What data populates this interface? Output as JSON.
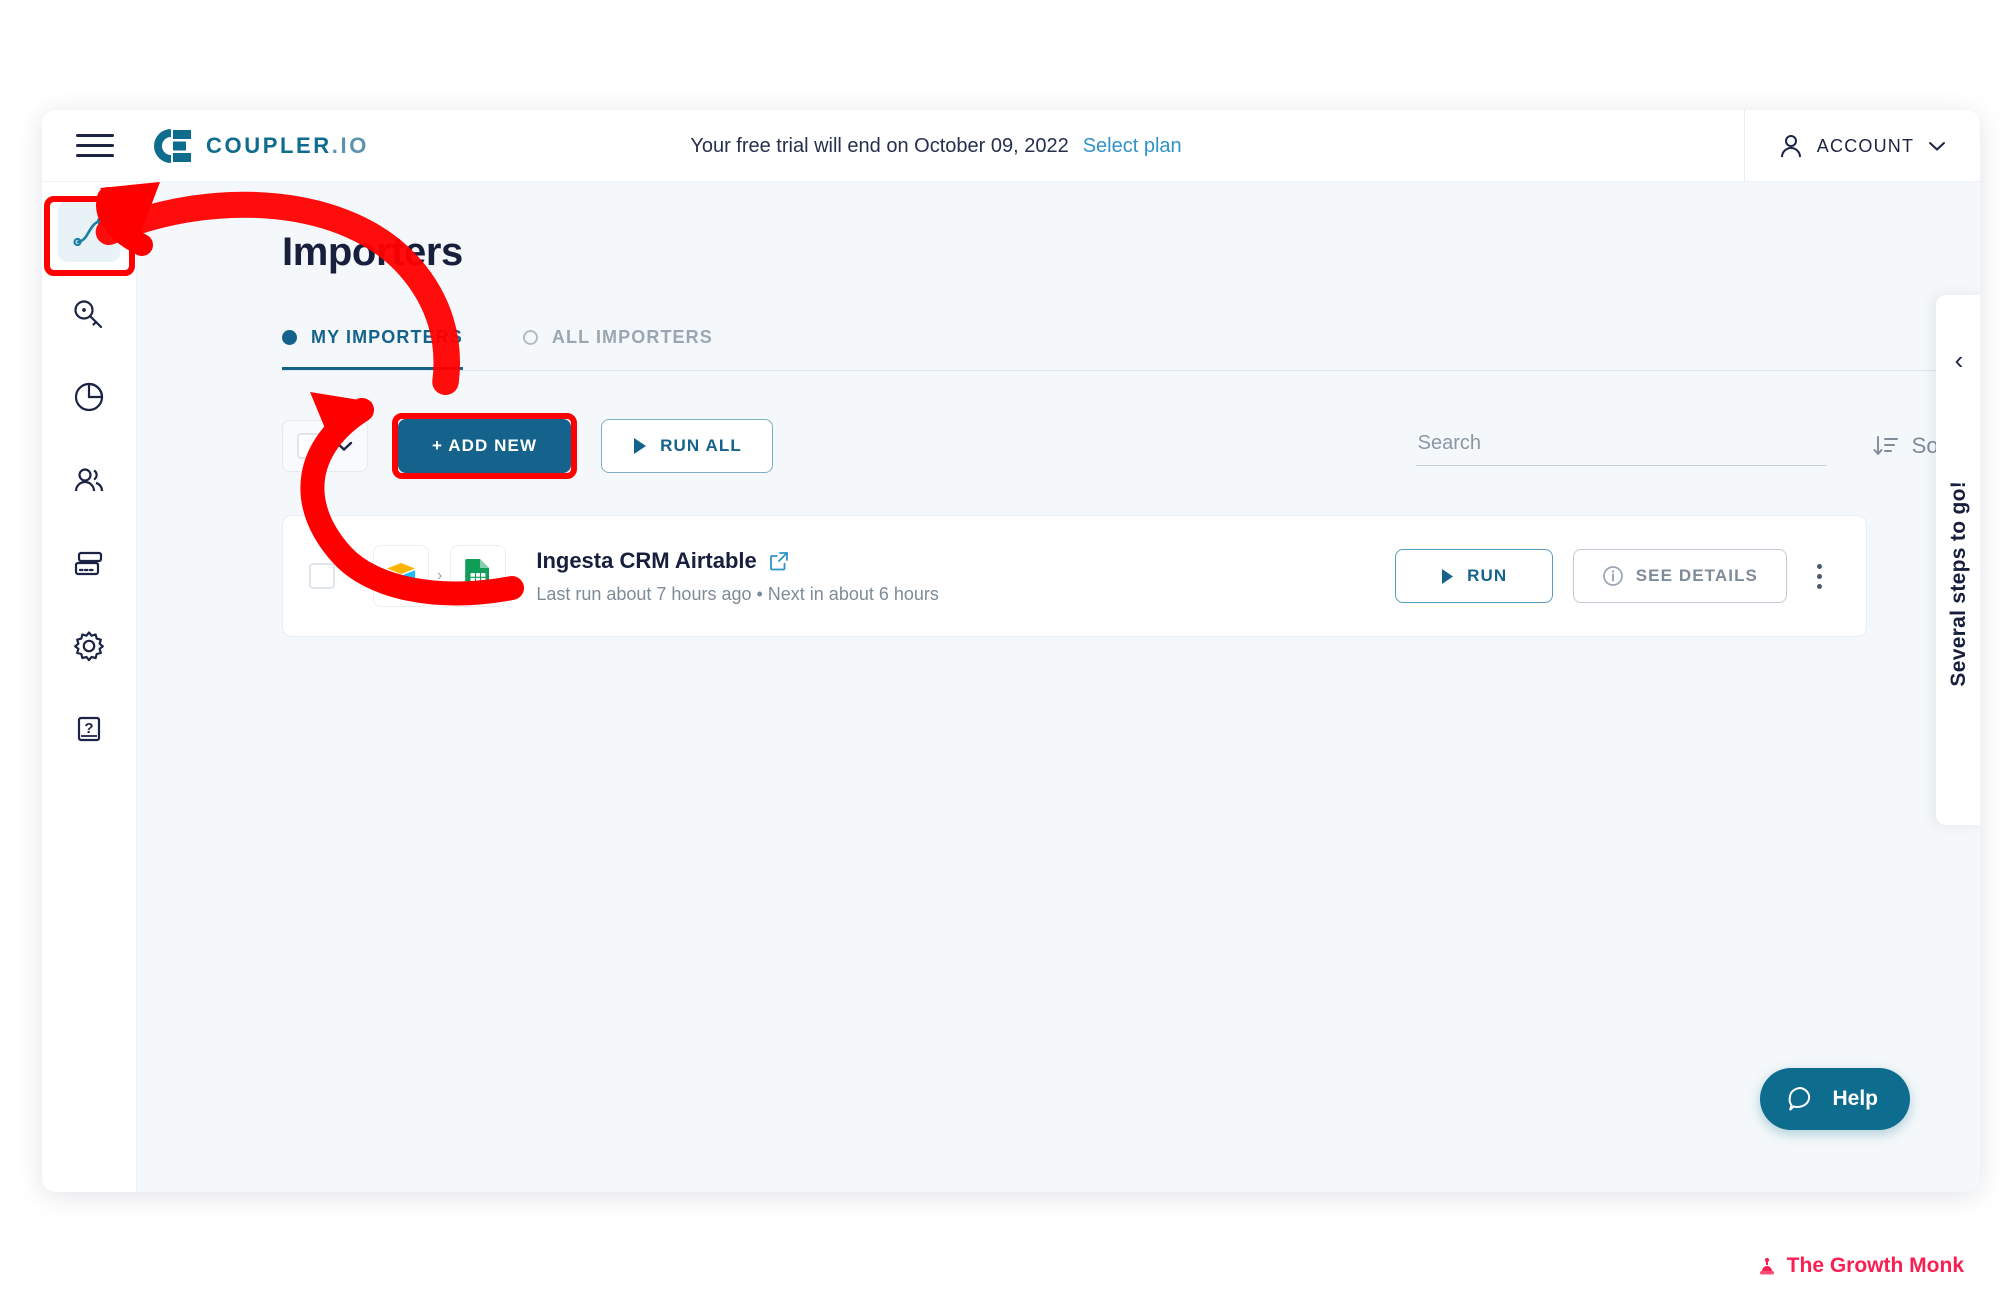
{
  "brand": {
    "name_main": "COUPLER",
    "name_suffix": ".IO"
  },
  "header": {
    "trial_text": "Your free trial will end on October 09, 2022",
    "select_plan_label": "Select plan",
    "account_label": "ACCOUNT",
    "menu_icon": "hamburger-menu-icon",
    "account_icon": "person-icon",
    "account_chevron": "chevron-down-icon"
  },
  "sidebar": {
    "items": [
      {
        "icon": "importers-flow-icon",
        "name": "importers",
        "active": true
      },
      {
        "icon": "key-icon",
        "name": "connections",
        "active": false
      },
      {
        "icon": "pie-chart-icon",
        "name": "usage",
        "active": false
      },
      {
        "icon": "users-icon",
        "name": "team",
        "active": false
      },
      {
        "icon": "credit-card-icon",
        "name": "billing",
        "active": false
      },
      {
        "icon": "gear-icon",
        "name": "settings",
        "active": false
      },
      {
        "icon": "help-book-icon",
        "name": "docs",
        "active": false
      }
    ]
  },
  "main": {
    "page_title": "Importers",
    "tabs": [
      {
        "label": "MY IMPORTERS",
        "active": true
      },
      {
        "label": "ALL IMPORTERS",
        "active": false
      }
    ],
    "toolbar": {
      "add_new_label": "+ ADD NEW",
      "run_all_label": "RUN ALL",
      "run_all_icon": "play-icon",
      "select_all_icon": "checkbox-icon",
      "select_all_chevron": "chevron-down-icon",
      "search_placeholder": "Search",
      "search_value": "",
      "sort_label": "Sort",
      "sort_icon": "sort-descending-icon"
    },
    "importers": [
      {
        "name": "Ingesta CRM Airtable",
        "status": "Last run about 7 hours ago • Next in about 6 hours",
        "source_icon": "airtable-icon",
        "destination_icon": "google-sheets-icon",
        "external_link_icon": "external-link-icon",
        "run_label": "RUN",
        "run_icon": "play-icon",
        "details_label": "SEE DETAILS",
        "details_icon": "info-icon",
        "menu_icon": "kebab-menu-icon"
      }
    ]
  },
  "side_panel": {
    "collapse_icon": "chevron-left-icon",
    "text": "Several steps to go!"
  },
  "help": {
    "label": "Help",
    "icon": "chat-bubble-icon"
  },
  "watermark": {
    "label": "The Growth Monk",
    "icon": "hat-icon"
  },
  "colors": {
    "brand_teal": "#0e6c8e",
    "accent_blue": "#15638c",
    "link_blue": "#2f93c8",
    "annotation_red": "#ff0000",
    "watermark_pink": "#fa1f52",
    "page_bg": "#f4f8fa",
    "dark_navy": "#181f3d"
  }
}
